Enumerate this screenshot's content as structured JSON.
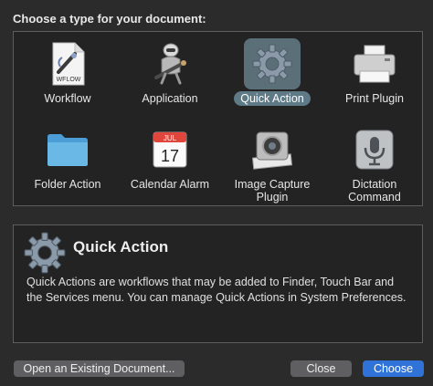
{
  "dialog": {
    "heading": "Choose a type for your document:"
  },
  "types": [
    {
      "label": "Workflow",
      "icon": "workflow-document-icon",
      "badge": "WFLOW",
      "selected": false
    },
    {
      "label": "Application",
      "icon": "automator-robot-icon",
      "selected": false
    },
    {
      "label": "Quick Action",
      "icon": "gear-icon",
      "selected": true
    },
    {
      "label": "Print Plugin",
      "icon": "printer-icon",
      "selected": false
    },
    {
      "label": "Folder Action",
      "icon": "folder-icon",
      "selected": false
    },
    {
      "label": "Calendar Alarm",
      "icon": "calendar-icon",
      "month": "JUL",
      "day": "17",
      "selected": false
    },
    {
      "label": "Image Capture Plugin",
      "icon": "image-capture-icon",
      "selected": false
    },
    {
      "label": "Dictation Command",
      "icon": "microphone-icon",
      "selected": false
    }
  ],
  "description": {
    "title": "Quick Action",
    "text": "Quick Actions are workflows that may be added to Finder, Touch Bar and the Services menu. You can manage Quick Actions in System Preferences."
  },
  "buttons": {
    "open_existing": "Open an Existing Document...",
    "close": "Close",
    "choose": "Choose"
  },
  "colors": {
    "accent": "#2f73d8",
    "selection": "#5e7a86"
  }
}
